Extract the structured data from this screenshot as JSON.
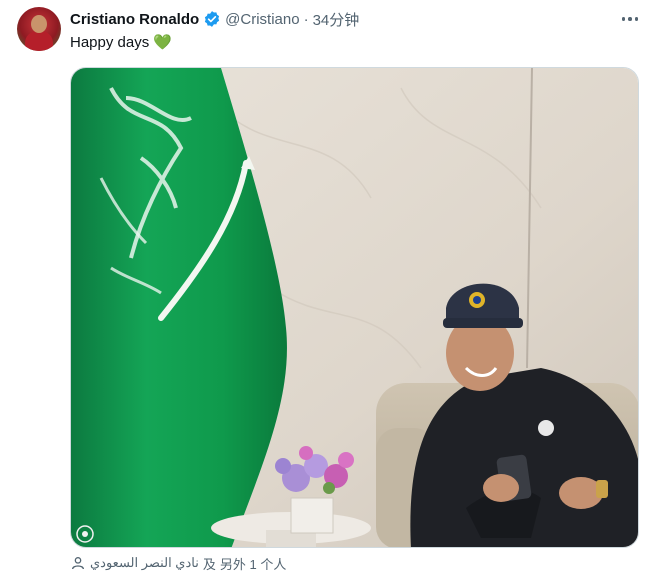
{
  "tweet": {
    "author_name": "Cristiano Ronaldo",
    "verified": true,
    "handle": "@Cristiano",
    "separator": "·",
    "time": "34分钟",
    "text": "Happy days 💚",
    "more_icon": "more-horizontal-icon",
    "verified_icon": "verified-badge-icon",
    "verified_color": "#1d9bf0"
  },
  "media": {
    "flag_color": "#0d9a4e"
  },
  "tags": {
    "icon": "user-tag-icon",
    "first_tag": "نادي النصر السعودي",
    "joiner": "及",
    "others": "另外 1 个人"
  }
}
